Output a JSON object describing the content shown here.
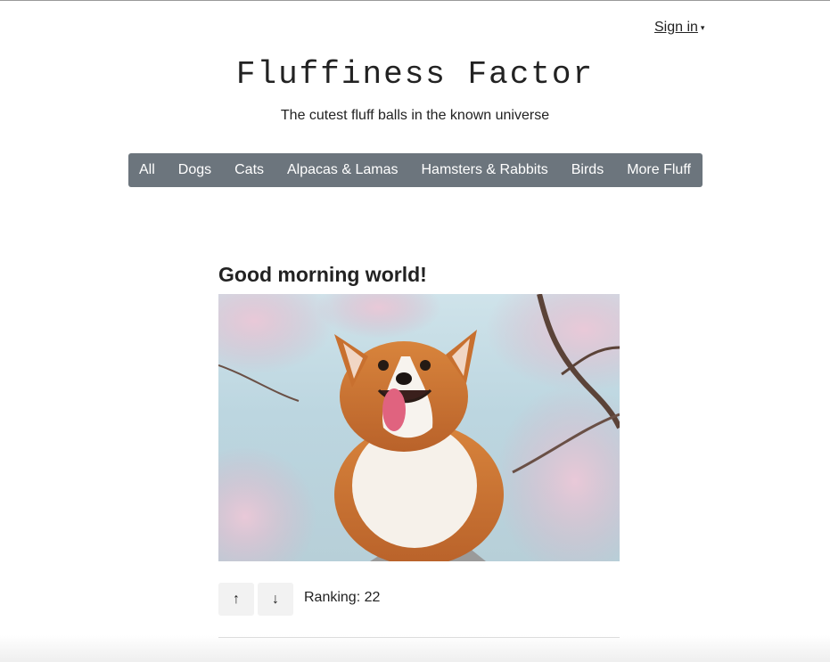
{
  "header": {
    "signin_label": "Sign in",
    "signin_caret": "▾",
    "site_title": "Fluffiness Factor",
    "tagline": "The cutest fluff balls in the known universe"
  },
  "nav": {
    "items": [
      {
        "label": "All"
      },
      {
        "label": "Dogs"
      },
      {
        "label": "Cats"
      },
      {
        "label": "Alpacas & Lamas"
      },
      {
        "label": "Hamsters & Rabbits"
      },
      {
        "label": "Birds"
      },
      {
        "label": "More Fluff"
      }
    ],
    "background": "#6c757d"
  },
  "post": {
    "title": "Good morning world!",
    "image_subject": "corgi under cherry blossoms",
    "upvote_icon": "arrow-up-icon",
    "upvote_glyph": "↑",
    "downvote_icon": "arrow-down-icon",
    "downvote_glyph": "↓",
    "ranking_text": "Ranking: 22"
  }
}
